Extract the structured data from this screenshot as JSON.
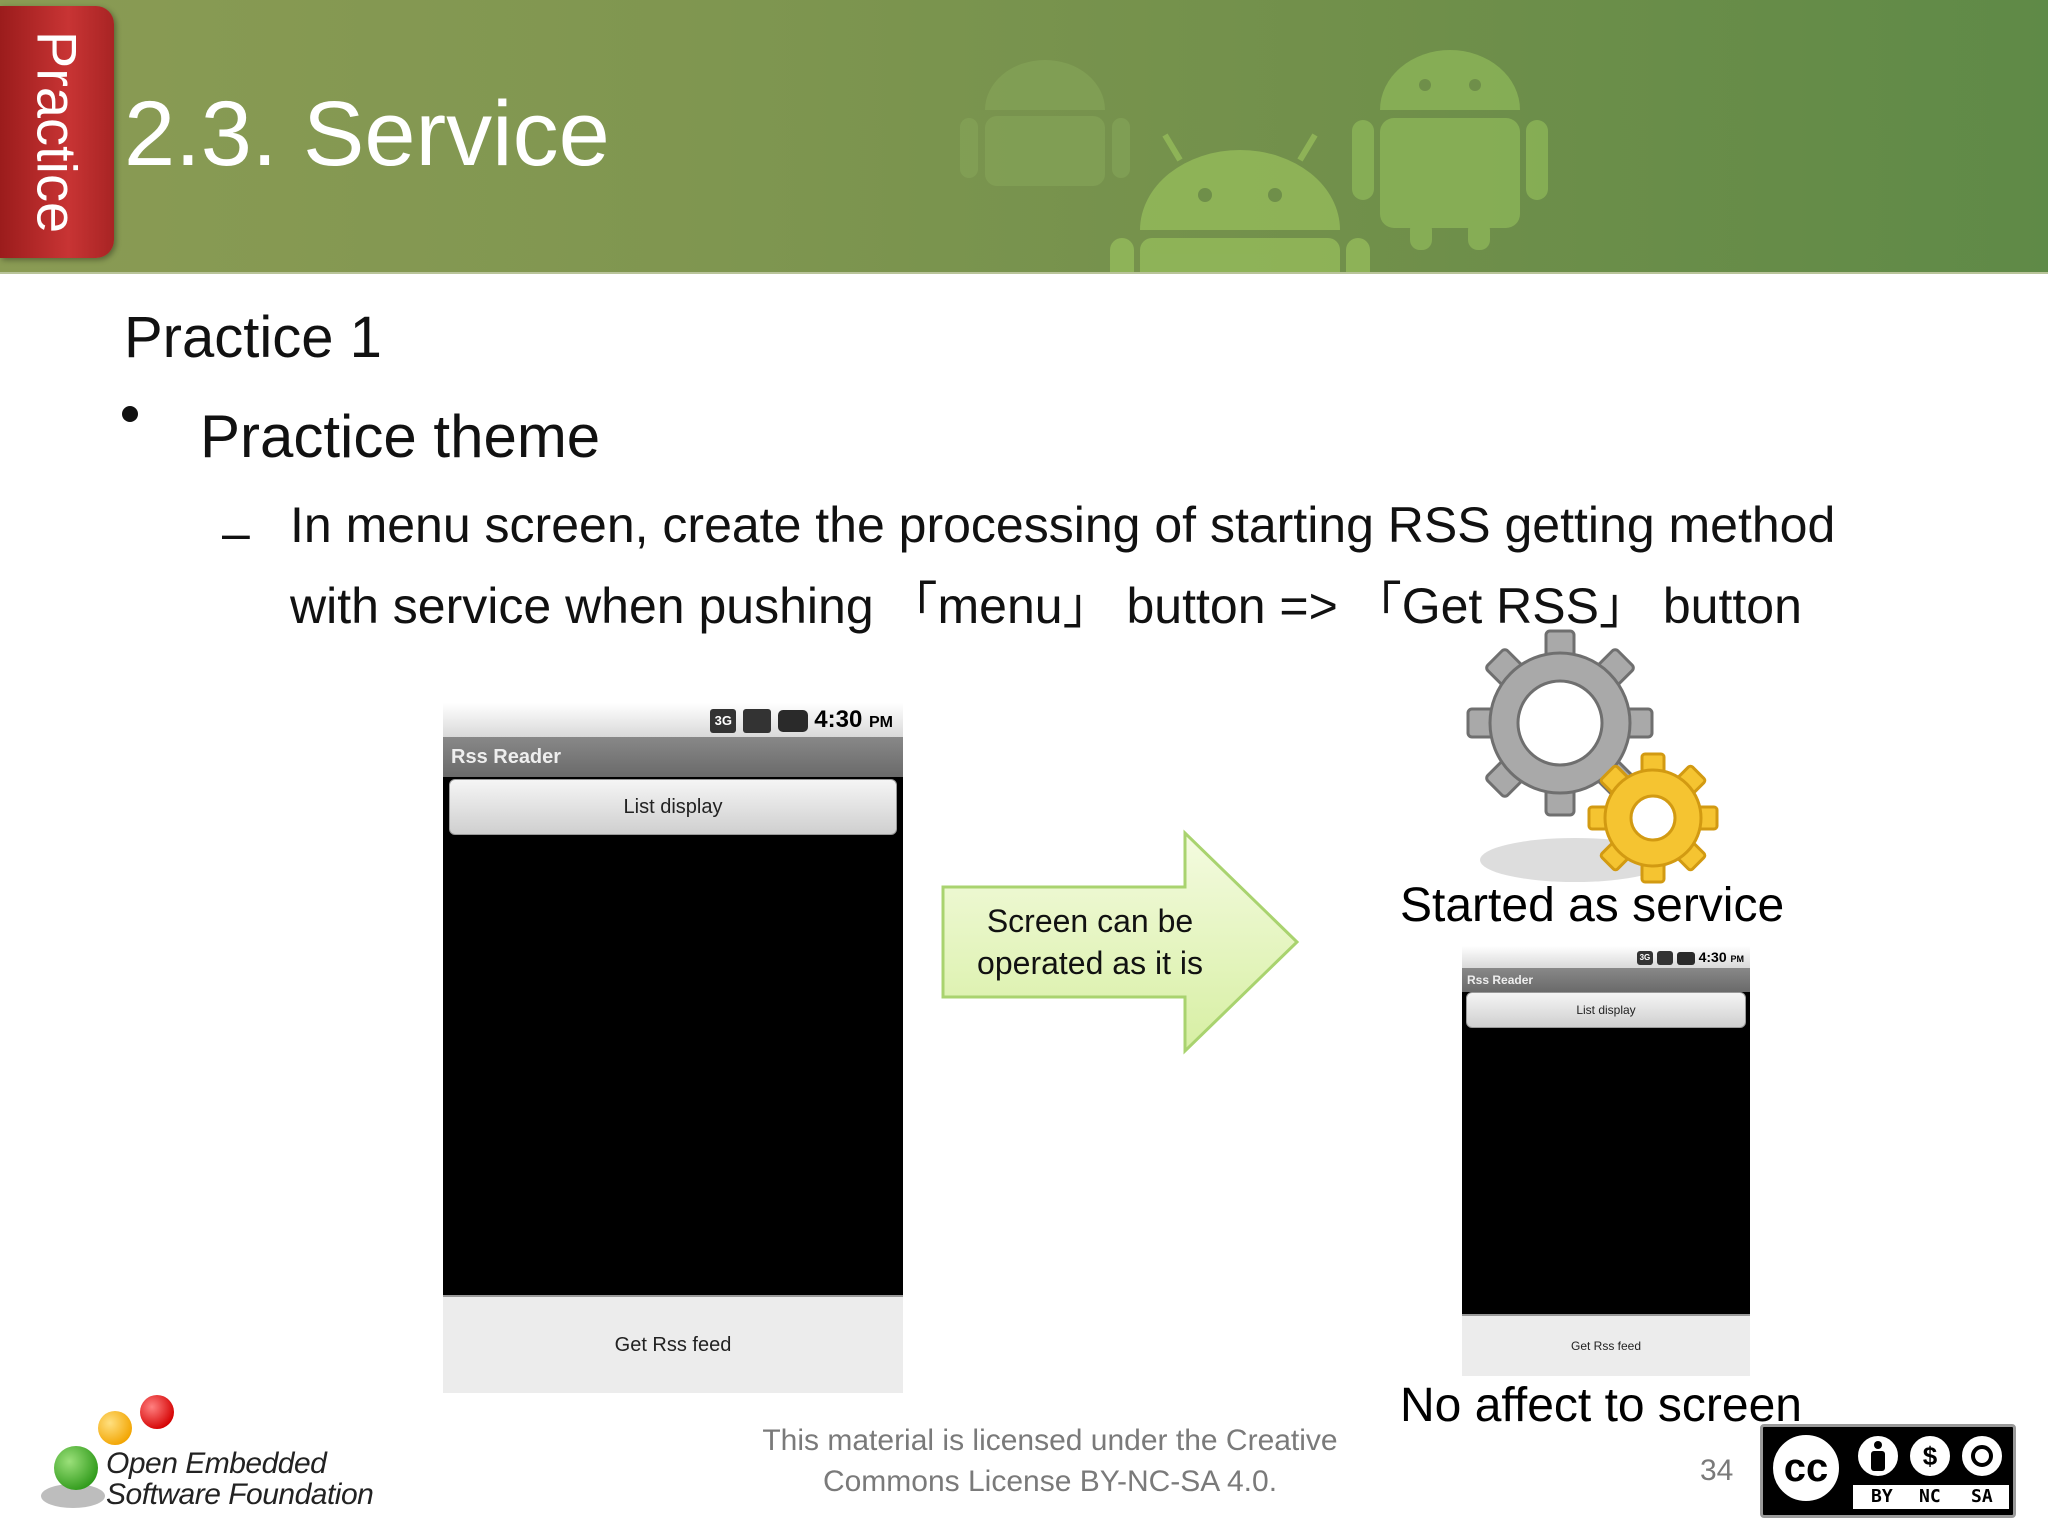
{
  "header": {
    "tab_label": "Practice",
    "title": "2.3. Service"
  },
  "content": {
    "subtitle": "Practice 1",
    "bullet": "Practice theme",
    "sub_bullet_line1": "In menu screen, create the processing of starting RSS getting method",
    "sub_bullet_line2": "with service when pushing 「menu」 button => 「Get RSS」 button"
  },
  "phone_large": {
    "status_time": "4:30",
    "status_ampm": "PM",
    "status_icon_1": "3G",
    "titlebar": "Rss Reader",
    "top_button": "List display",
    "bottom_button": "Get Rss feed"
  },
  "arrow": {
    "line1": "Screen can be",
    "line2": "operated as it is",
    "fill_color": "#e8f7c4",
    "stroke_color": "#a9d36f"
  },
  "right_panel": {
    "started_label": "Started as service",
    "no_affect_label": "No affect to screen"
  },
  "phone_small": {
    "status_time": "4:30",
    "status_ampm": "PM",
    "status_icon_1": "3G",
    "titlebar": "Rss Reader",
    "top_button": "List display",
    "bottom_button": "Get Rss feed"
  },
  "footer": {
    "license_line1": "This material is licensed under the Creative",
    "license_line2": "Commons License BY-NC-SA 4.0.",
    "page_number": "34",
    "org_line1": "Open Embedded",
    "org_line2": "Software Foundation",
    "cc_label": "cc",
    "cc_by": "BY",
    "cc_nc": "NC",
    "cc_sa": "SA"
  },
  "colors": {
    "header_green": "#7f9650",
    "practice_red": "#c83434",
    "gear_gray": "#9a9a9a",
    "gear_yellow": "#f5c431"
  }
}
